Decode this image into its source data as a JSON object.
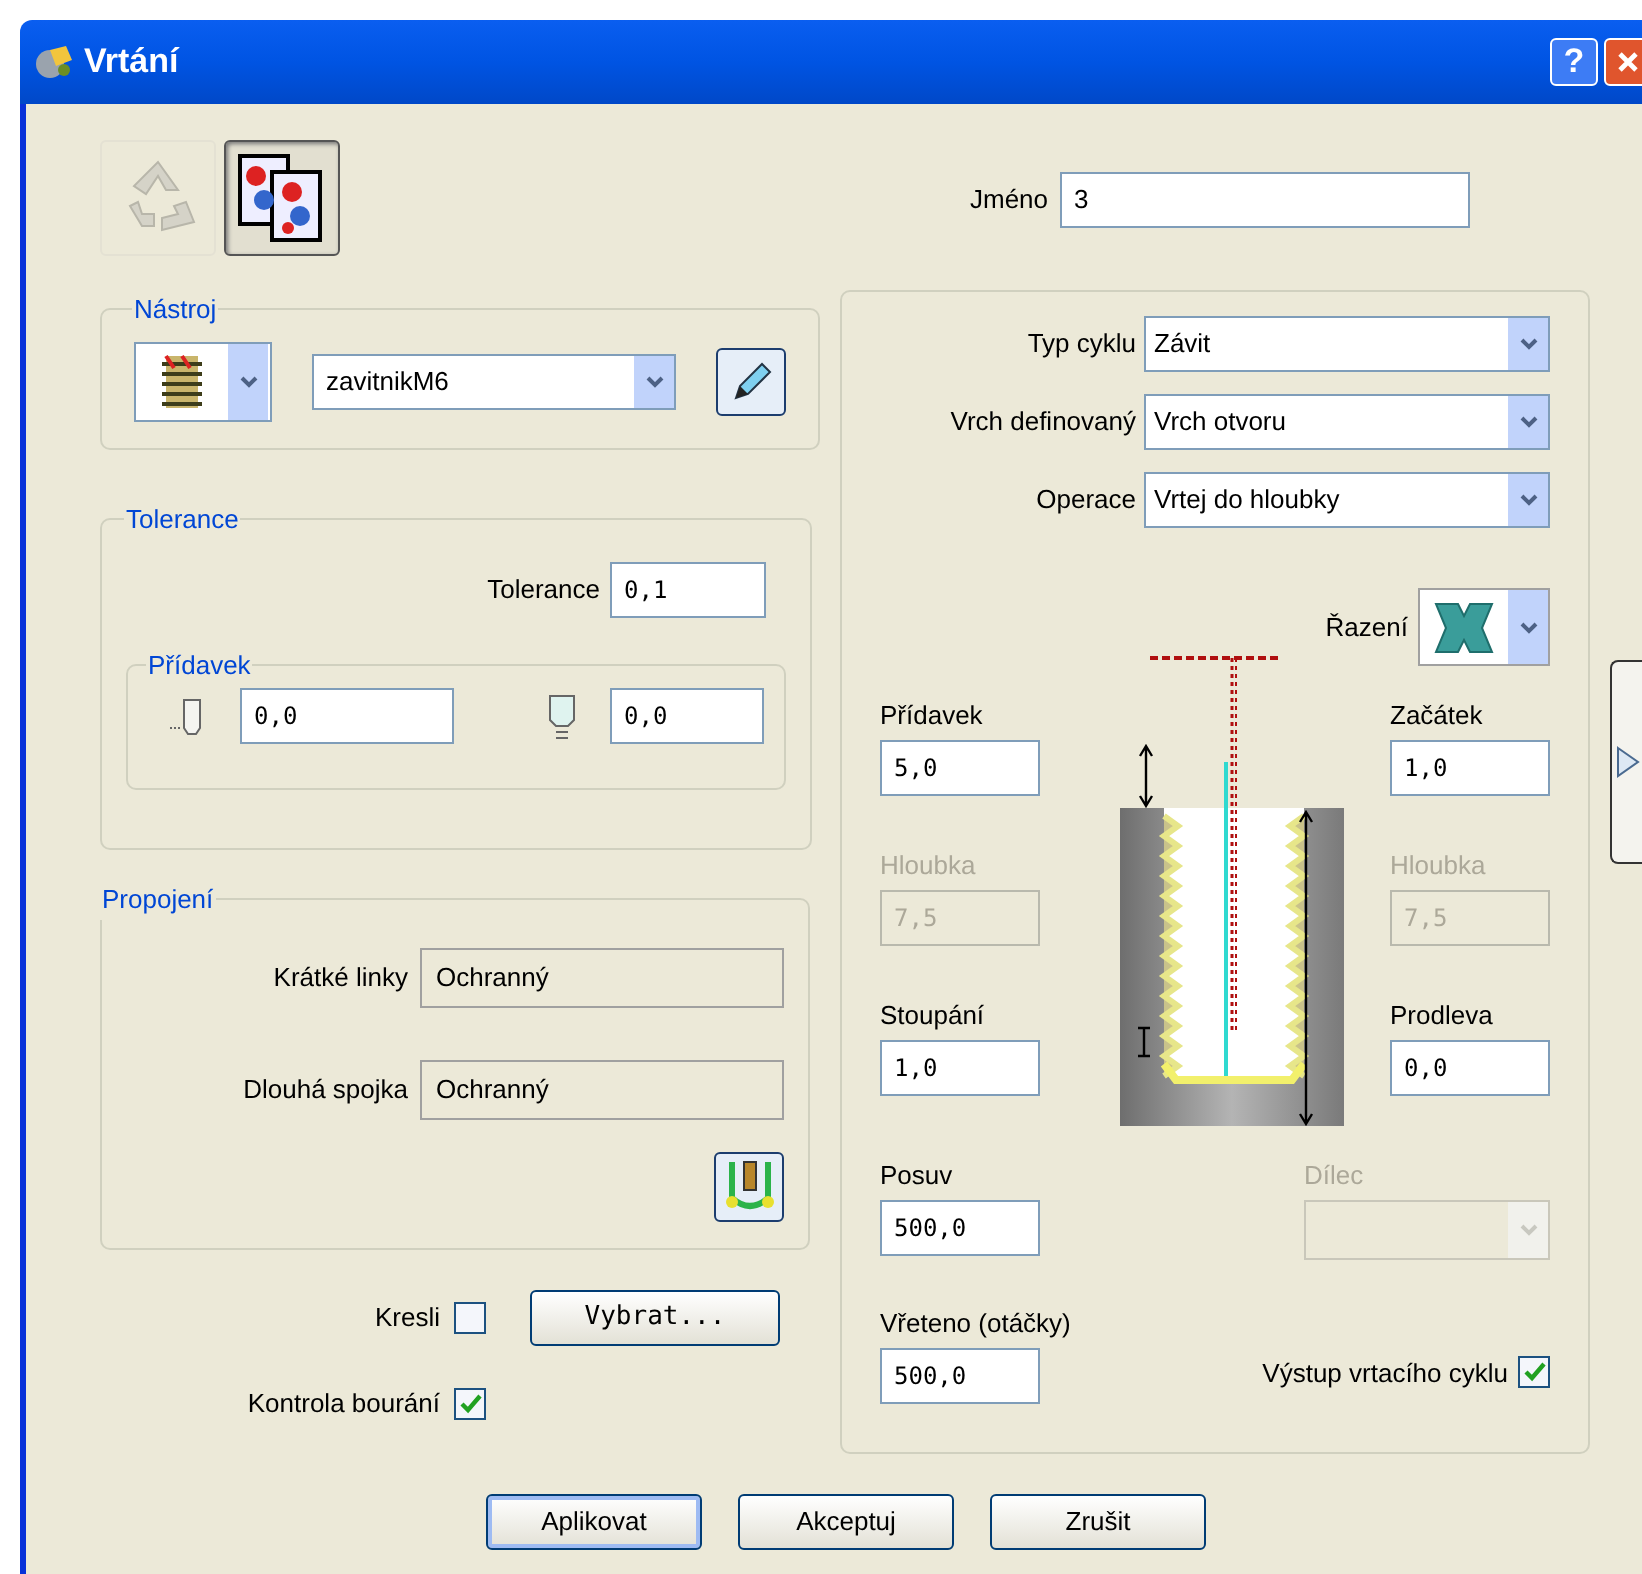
{
  "window": {
    "title": "Vrtání",
    "help": "?"
  },
  "mode_buttons": [
    {
      "selected": false
    },
    {
      "selected": true
    }
  ],
  "name_field": {
    "label": "Jméno",
    "value": "3"
  },
  "tool_group": {
    "title": "Nástroj",
    "tool": "zavitnikM6"
  },
  "tolerance_group": {
    "title": "Tolerance",
    "label": "Tolerance",
    "value": "0,1",
    "allowance": {
      "title": "Přídavek",
      "radial": "0,0",
      "axial": "0,0"
    }
  },
  "links_group": {
    "title": "Propojení",
    "fields": [
      {
        "label": "Krátké linky",
        "value": "Ochranný"
      },
      {
        "label": "Dlouhá spojka",
        "value": "Ochranný"
      }
    ]
  },
  "draw": {
    "label": "Kresli",
    "checked": false
  },
  "select_button": "Vybrat...",
  "collision_check": {
    "label": "Kontrola bourání",
    "checked": true
  },
  "cycle": {
    "dropdowns": [
      {
        "label": "Typ cyklu",
        "value": "Závit"
      },
      {
        "label": "Vrch definovaný",
        "value": "Vrch otvoru"
      },
      {
        "label": "Operace",
        "value": "Vrtej do hloubky"
      }
    ],
    "ordering_label": "Řazení",
    "params_left": [
      {
        "label": "Přídavek",
        "value": "5,0",
        "disabled": false
      },
      {
        "label": "Hloubka",
        "value": "7,5",
        "disabled": true
      },
      {
        "label": "Stoupání",
        "value": "1,0",
        "disabled": false
      }
    ],
    "params_right": [
      {
        "label": "Začátek",
        "value": "1,0",
        "disabled": false
      },
      {
        "label": "Hloubka",
        "value": "7,5",
        "disabled": true
      },
      {
        "label": "Prodleva",
        "value": "0,0",
        "disabled": false
      }
    ],
    "feed": {
      "label": "Posuv",
      "value": "500,0"
    },
    "part": {
      "label": "Dílec",
      "disabled": true
    },
    "spindle": {
      "label": "Vřeteno (otáčky)",
      "value": "500,0"
    },
    "output": {
      "label": "Výstup vrtacího cyklu",
      "checked": true
    }
  },
  "buttons": [
    {
      "label": "Aplikovat",
      "default": true
    },
    {
      "label": "Akceptuj",
      "default": false
    },
    {
      "label": "Zrušit",
      "default": false
    }
  ]
}
